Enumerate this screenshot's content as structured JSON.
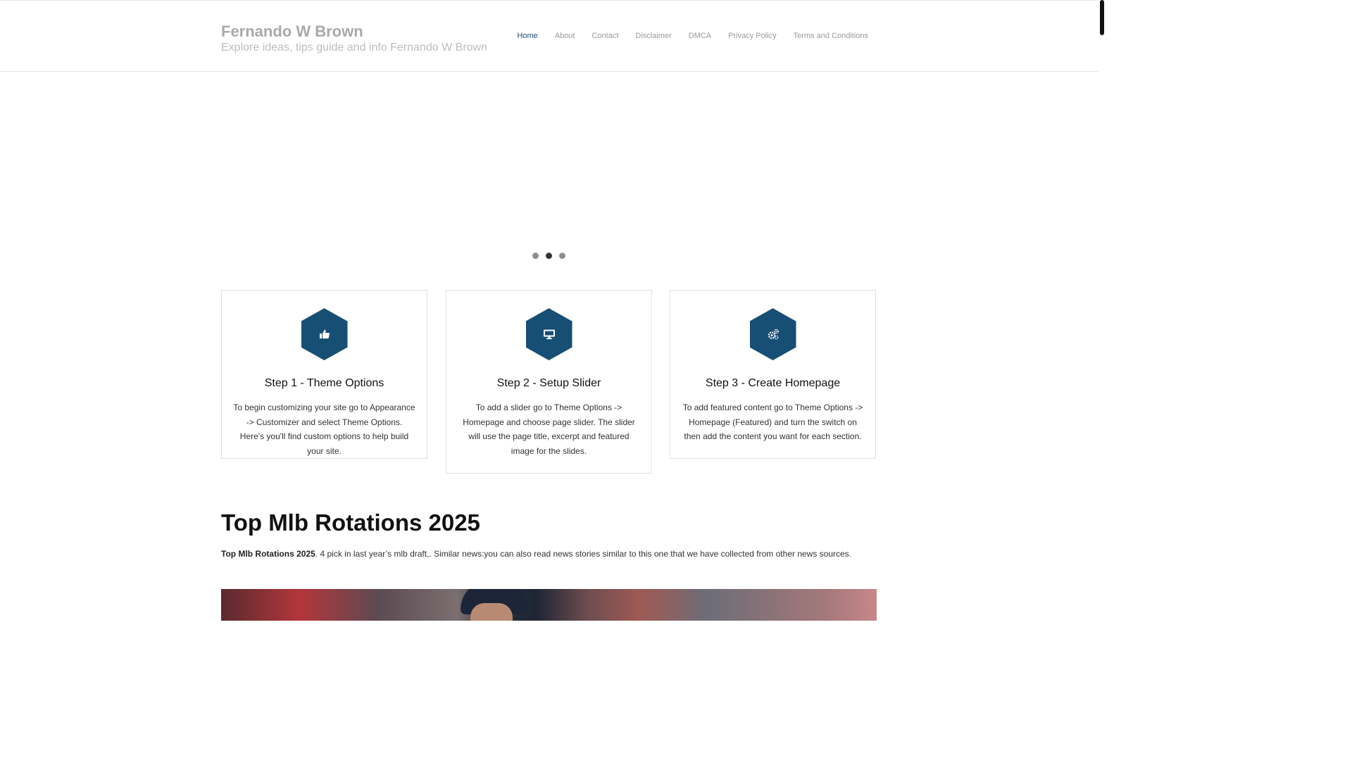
{
  "site": {
    "title": "Fernando W Brown",
    "tagline": "Explore ideas, tips guide and info Fernando W Brown"
  },
  "nav": {
    "items": [
      {
        "label": "Home",
        "active": true
      },
      {
        "label": "About"
      },
      {
        "label": "Contact"
      },
      {
        "label": "Disclaimer"
      },
      {
        "label": "DMCA"
      },
      {
        "label": "Privacy Policy"
      },
      {
        "label": "Terms and Conditions"
      }
    ]
  },
  "slider": {
    "dot_count": 3,
    "active_dot": 2
  },
  "steps": [
    {
      "icon": "thumbs-up-icon",
      "title": "Step 1 - Theme Options",
      "text": "To begin customizing your site go to Appearance -> Customizer and select Theme Options. Here's you'll find custom options to help build your site."
    },
    {
      "icon": "desktop-icon",
      "title": "Step 2 - Setup Slider",
      "text": "To add a slider go to Theme Options -> Homepage and choose page slider. The slider will use the page title, excerpt and featured image for the slides."
    },
    {
      "icon": "gears-icon",
      "title": "Step 3 - Create Homepage",
      "text": "To add featured content go to Theme Options -> Homepage (Featured) and turn the switch on then add the content you want for each section."
    }
  ],
  "post": {
    "title": "Top Mlb Rotations 2025",
    "excerpt_bold": "Top Mlb Rotations 2025",
    "excerpt_rest": ". 4 pick in last year’s mlb draft,. Similar news:you can also read news stories similar to this one that we have collected from other news sources."
  },
  "colors": {
    "accent": "#174f74",
    "nav_active": "#1b4f75",
    "muted_text": "#a9a9a9"
  }
}
